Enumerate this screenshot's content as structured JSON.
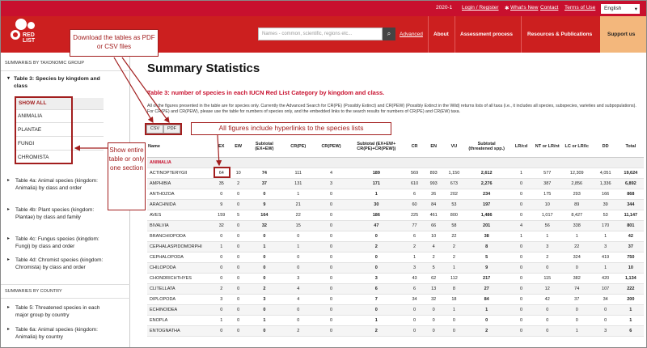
{
  "topbar": {
    "version": "2020-1",
    "login": "Login / Register",
    "whats_new": "What's New",
    "contact": "Contact",
    "terms": "Terms of Use",
    "language": "English"
  },
  "logo": {
    "text": "RED LIST"
  },
  "nav": {
    "search_placeholder": "Names - common, scientific, regions etc...",
    "advanced": "Advanced",
    "about": "About",
    "assessment": "Assessment process",
    "resources": "Resources & Publications",
    "support": "Support us"
  },
  "sidebar": {
    "heading1": "SUMMARIES BY TAXONOMIC GROUP",
    "table3": "Table 3: Species by kingdom and class",
    "subitems": [
      "SHOW ALL",
      "ANIMALIA",
      "PLANTAE",
      "FUNGI",
      "CHROMISTA"
    ],
    "items": [
      "Table 4a: Animal species (kingdom: Animalia) by class and order",
      "Table 4b: Plant species (kingdom: Plantae) by class and family",
      "Table 4c: Fungus species (kingdom: Fungi) by class and order",
      "Table 4d: Chromist species (kingdom: Chromista) by class and order"
    ],
    "heading2": "SUMMARIES BY COUNTRY",
    "country_items": [
      "Table 5: Threatened species in each major group by country",
      "Table 6a: Animal species (kingdom: Animalia) by country"
    ]
  },
  "main": {
    "title": "Summary Statistics",
    "subtitle": "Table 3: number of species in each IUCN Red List Category by kingdom and class.",
    "intro": "All of the figures presented in the table are for species only. Currently the Advanced Search for CR(PE) (Possibly Extinct) and CR(PEW) (Possibly Extinct in the Wild) returns lists of all taxa (i.e., it includes all species, subspecies, varieties and subpopulations). For CR(PE) and CR(PEW), please use the table for numbers of species only, and the embedded links to the search results for numbers of CR(PE) and CR(EW) taxa.",
    "csv": "CSV",
    "pdf": "PDF"
  },
  "table": {
    "headers": [
      "Name",
      "EX",
      "EW",
      "Subtotal (EX+EW)",
      "CR(PE)",
      "CR(PEW)",
      "Subtotal (EX+EW+ CR(PE)+CR(PEW))",
      "CR",
      "EN",
      "VU",
      "Subtotal (threatened spp.)",
      "LR/cd",
      "NT or LR/nt",
      "LC or LR/lc",
      "DD",
      "Total"
    ],
    "group": "ANIMALIA",
    "rows": [
      [
        "ACTINOPTERYGII",
        "64",
        "10",
        "74",
        "111",
        "4",
        "189",
        "569",
        "893",
        "1,150",
        "2,612",
        "1",
        "577",
        "12,309",
        "4,051",
        "19,624"
      ],
      [
        "AMPHIBIA",
        "35",
        "2",
        "37",
        "131",
        "3",
        "171",
        "610",
        "993",
        "673",
        "2,276",
        "0",
        "387",
        "2,856",
        "1,336",
        "6,892"
      ],
      [
        "ANTHOZOA",
        "0",
        "0",
        "0",
        "1",
        "0",
        "1",
        "6",
        "26",
        "202",
        "234",
        "0",
        "175",
        "293",
        "166",
        "868"
      ],
      [
        "ARACHNIDA",
        "9",
        "0",
        "9",
        "21",
        "0",
        "30",
        "60",
        "84",
        "53",
        "197",
        "0",
        "10",
        "89",
        "39",
        "344"
      ],
      [
        "AVES",
        "159",
        "5",
        "164",
        "22",
        "0",
        "186",
        "225",
        "461",
        "800",
        "1,486",
        "0",
        "1,017",
        "8,427",
        "53",
        "11,147"
      ],
      [
        "BIVALVIA",
        "32",
        "0",
        "32",
        "15",
        "0",
        "47",
        "77",
        "66",
        "58",
        "201",
        "4",
        "56",
        "338",
        "170",
        "801"
      ],
      [
        "BRANCHIOPODA",
        "0",
        "0",
        "0",
        "0",
        "0",
        "0",
        "6",
        "10",
        "22",
        "38",
        "1",
        "1",
        "1",
        "1",
        "42"
      ],
      [
        "CEPHALASPIDOMORPHI",
        "1",
        "0",
        "1",
        "1",
        "0",
        "2",
        "2",
        "4",
        "2",
        "8",
        "0",
        "3",
        "22",
        "3",
        "37"
      ],
      [
        "CEPHALOPODA",
        "0",
        "0",
        "0",
        "0",
        "0",
        "0",
        "1",
        "2",
        "2",
        "5",
        "0",
        "2",
        "324",
        "419",
        "750"
      ],
      [
        "CHILOPODA",
        "0",
        "0",
        "0",
        "0",
        "0",
        "0",
        "3",
        "5",
        "1",
        "9",
        "0",
        "0",
        "0",
        "1",
        "10"
      ],
      [
        "CHONDRICHTHYES",
        "0",
        "0",
        "0",
        "3",
        "0",
        "3",
        "43",
        "62",
        "112",
        "217",
        "0",
        "115",
        "382",
        "420",
        "1,134"
      ],
      [
        "CLITELLATA",
        "2",
        "0",
        "2",
        "4",
        "0",
        "6",
        "6",
        "13",
        "8",
        "27",
        "0",
        "12",
        "74",
        "107",
        "222"
      ],
      [
        "DIPLOPODA",
        "3",
        "0",
        "3",
        "4",
        "0",
        "7",
        "34",
        "32",
        "18",
        "84",
        "0",
        "42",
        "37",
        "34",
        "200"
      ],
      [
        "ECHINOIDEA",
        "0",
        "0",
        "0",
        "0",
        "0",
        "0",
        "0",
        "0",
        "1",
        "1",
        "0",
        "0",
        "0",
        "0",
        "1"
      ],
      [
        "ENOPLA",
        "1",
        "0",
        "1",
        "0",
        "0",
        "1",
        "0",
        "0",
        "0",
        "0",
        "0",
        "0",
        "0",
        "0",
        "1"
      ],
      [
        "ENTOGNATHA",
        "0",
        "0",
        "0",
        "2",
        "0",
        "2",
        "0",
        "0",
        "0",
        "2",
        "0",
        "0",
        "1",
        "3",
        "6"
      ]
    ]
  },
  "callouts": {
    "download": "Download the tables as PDF or CSV files",
    "hyperlinks": "All figures include hyperlinks to the species lists",
    "show": "Show entire table or only one section"
  }
}
